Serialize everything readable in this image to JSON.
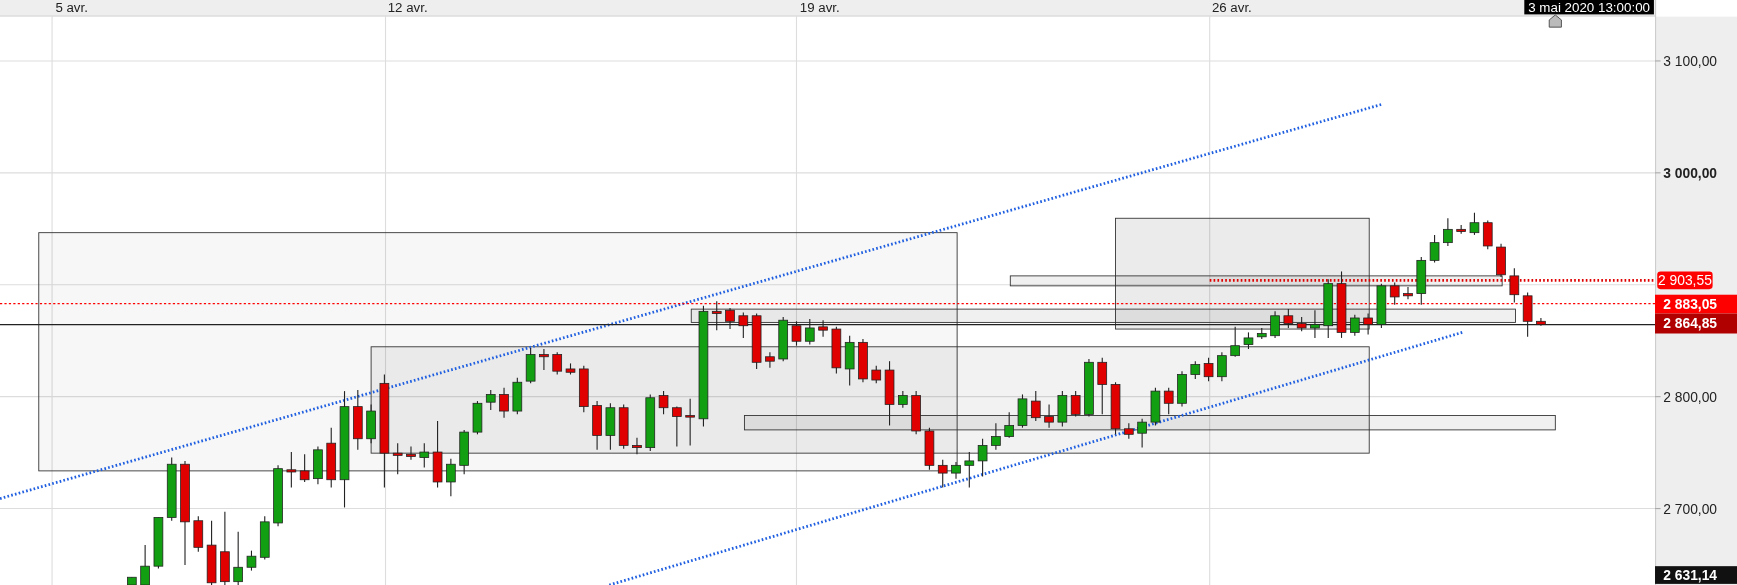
{
  "time_axis": {
    "labels": [
      "5 avr.",
      "12 avr.",
      "19 avr.",
      "26 avr."
    ],
    "cursor_label": "3 mai 2020 13:00:00"
  },
  "price_axis": {
    "labels": [
      {
        "text": "3 100,00",
        "bold": false
      },
      {
        "text": "3 000,00",
        "bold": true
      },
      {
        "text": "2 800,00",
        "bold": false
      },
      {
        "text": "2 700,00",
        "bold": false
      }
    ]
  },
  "price_badges": [
    {
      "text": "2 903,55",
      "color": "#ff0000"
    },
    {
      "text": "2 883,05",
      "color": "#ff0000"
    },
    {
      "text": "2 864,85",
      "color": "#b00000"
    },
    {
      "text": "2 631,14",
      "color": "#111111"
    }
  ]
}
